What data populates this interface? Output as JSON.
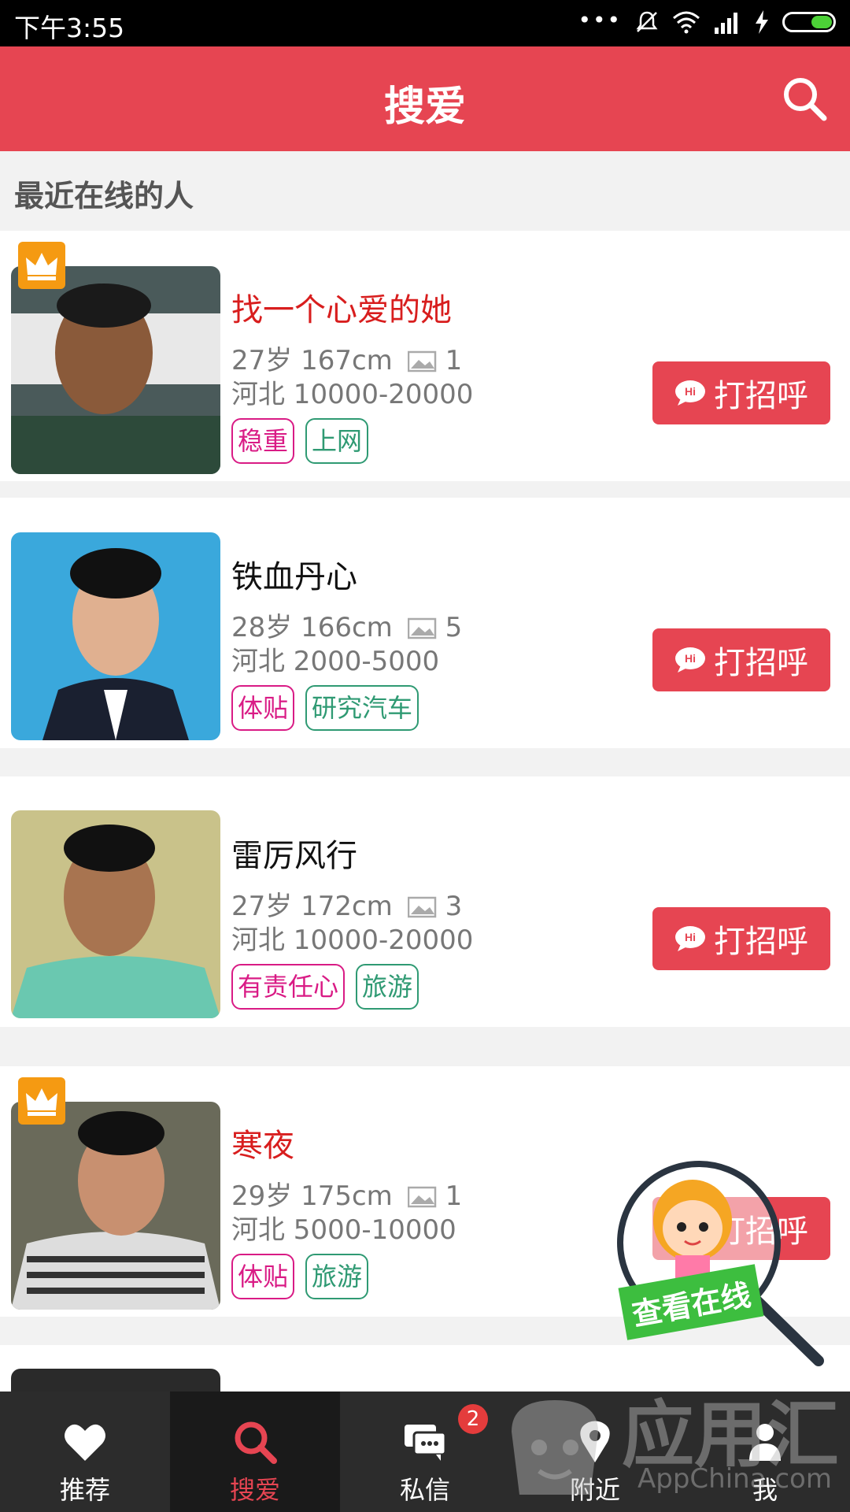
{
  "status_bar": {
    "time": "下午3:55"
  },
  "header": {
    "title": "搜爱"
  },
  "section": {
    "label": "最近在线的人"
  },
  "cards": [
    {
      "vip": true,
      "name": "找一个心爱的她",
      "age": "27岁",
      "height": "167cm",
      "photos": "1",
      "location": "河北 10000-20000",
      "tags": [
        "稳重",
        "上网"
      ],
      "button": "打招呼"
    },
    {
      "vip": false,
      "name": "铁血丹心",
      "age": "28岁",
      "height": "166cm",
      "photos": "5",
      "location": "河北 2000-5000",
      "tags": [
        "体贴",
        "研究汽车"
      ],
      "button": "打招呼"
    },
    {
      "vip": false,
      "name": "雷厉风行",
      "age": "27岁",
      "height": "172cm",
      "photos": "3",
      "location": "河北 10000-20000",
      "tags": [
        "有责任心",
        "旅游"
      ],
      "button": "打招呼"
    },
    {
      "vip": true,
      "name": "寒夜",
      "age": "29岁",
      "height": "175cm",
      "photos": "1",
      "location": "河北 5000-10000",
      "tags": [
        "体贴",
        "旅游"
      ],
      "button": "打招呼"
    }
  ],
  "float_widget": {
    "label": "查看在线"
  },
  "bottom_nav": {
    "items": [
      {
        "label": "推荐",
        "icon": "heart-icon"
      },
      {
        "label": "搜爱",
        "icon": "search-icon"
      },
      {
        "label": "私信",
        "icon": "chat-icon"
      },
      {
        "label": "附近",
        "icon": "location-icon"
      },
      {
        "label": "我",
        "icon": "user-icon"
      }
    ],
    "message_badge": "2"
  },
  "watermark": {
    "text": "应用汇",
    "sub": "AppChina.com"
  },
  "colors": {
    "accent": "#e64552",
    "vip_name": "#d81e1e",
    "tag_pink": "#d91b85",
    "tag_green": "#2f9a73"
  }
}
